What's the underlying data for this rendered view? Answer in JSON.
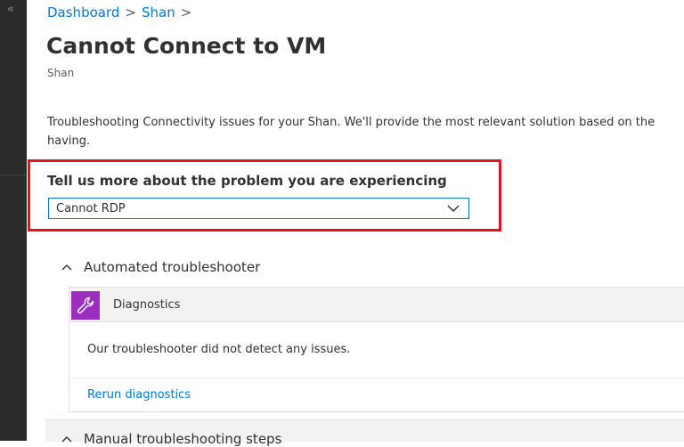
{
  "nav": {
    "collapse_glyph": "«"
  },
  "breadcrumb": {
    "items": [
      "Dashboard",
      "Shan"
    ],
    "separator": ">"
  },
  "page": {
    "title": "Cannot Connect to VM",
    "subtitle": "Shan",
    "description_line1": "Troubleshooting Connectivity issues for your Shan. We'll provide the most relevant solution based on the",
    "description_line2": "having."
  },
  "problem": {
    "label": "Tell us more about the problem you are experiencing",
    "selected": "Cannot RDP"
  },
  "automated": {
    "header": "Automated troubleshooter",
    "card_title": "Diagnostics",
    "message": "Our troubleshooter did not detect any issues.",
    "rerun_link": "Rerun diagnostics"
  },
  "manual": {
    "header": "Manual troubleshooting steps"
  },
  "icons": {
    "collapse": "double-chevron-left-icon",
    "dropdown": "chevron-down-icon",
    "section": "chevron-up-icon",
    "diagnostics": "wrench-icon"
  },
  "colors": {
    "accent": "#0078d4",
    "highlight": "#e8101e",
    "diagnostics_icon_bg": "#9b2ec0",
    "sidebar": "#2b2b2b"
  }
}
